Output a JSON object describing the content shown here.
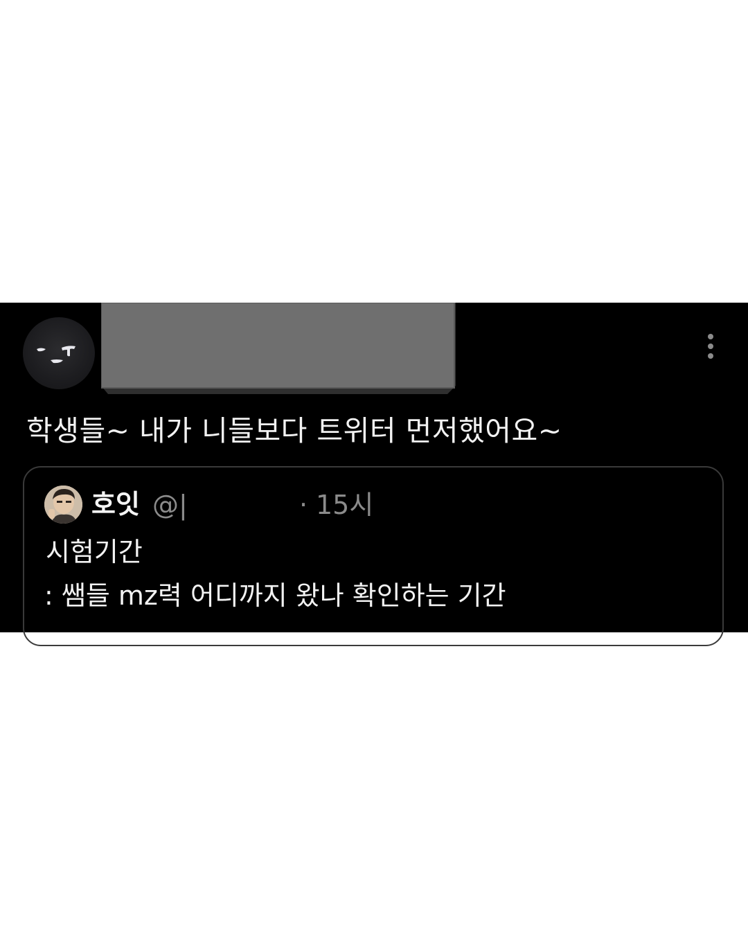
{
  "post": {
    "avatar_icon": "avatar-icon",
    "name_redacted": true,
    "more_icon": "more-vertical-icon",
    "text": "학생들~ 내가 니들보다 트위터 먼저했어요~"
  },
  "quoted_post": {
    "avatar_icon": "user-avatar-photo",
    "display_name": "호잇",
    "handle": "@|",
    "separator": "·",
    "time": "15시",
    "line1": "시험기간",
    "line2": ": 쌤들 mz력 어디까지 왔나 확인하는 기간"
  },
  "colors": {
    "background": "#000000",
    "text_primary": "#f2f2f2",
    "text_secondary": "#8b8b8b",
    "border": "#3a3a3a",
    "page_background": "#ffffff"
  }
}
